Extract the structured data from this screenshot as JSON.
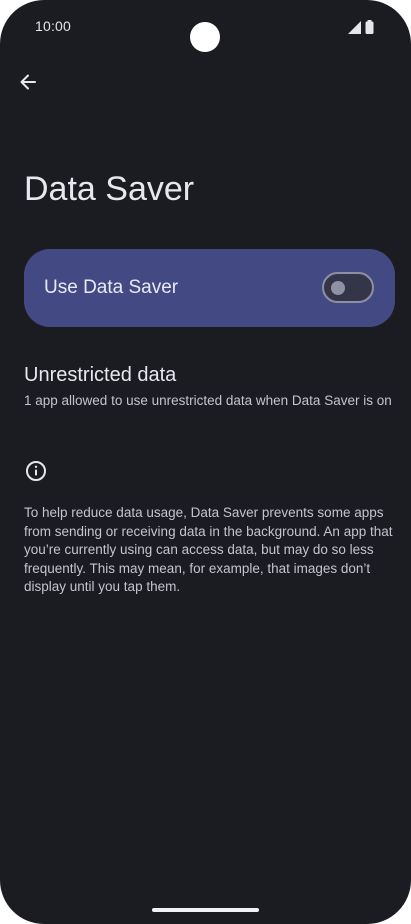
{
  "status_bar": {
    "time": "10:00",
    "icons": [
      "signal-icon",
      "battery-icon"
    ]
  },
  "colors": {
    "background": "#1b1b22",
    "card": "#434a83",
    "text_primary": "#e7e7ee",
    "text_secondary": "#c4c4cf",
    "toggle_off": "#8f91a6"
  },
  "toolbar": {
    "back_icon": "arrow-back-icon"
  },
  "page": {
    "title": "Data Saver"
  },
  "main_switch": {
    "label": "Use Data Saver",
    "checked": false
  },
  "unrestricted_data": {
    "title": "Unrestricted data",
    "summary": "1 app allowed to use unrestricted data when Data Saver is on"
  },
  "footer": {
    "icon": "info-icon",
    "text": "To help reduce data usage, Data Saver prevents some apps from sending or receiving data in the background. An app that you’re currently using can access data, but may do so less frequently. This may mean, for example, that images don’t display until you tap them."
  }
}
